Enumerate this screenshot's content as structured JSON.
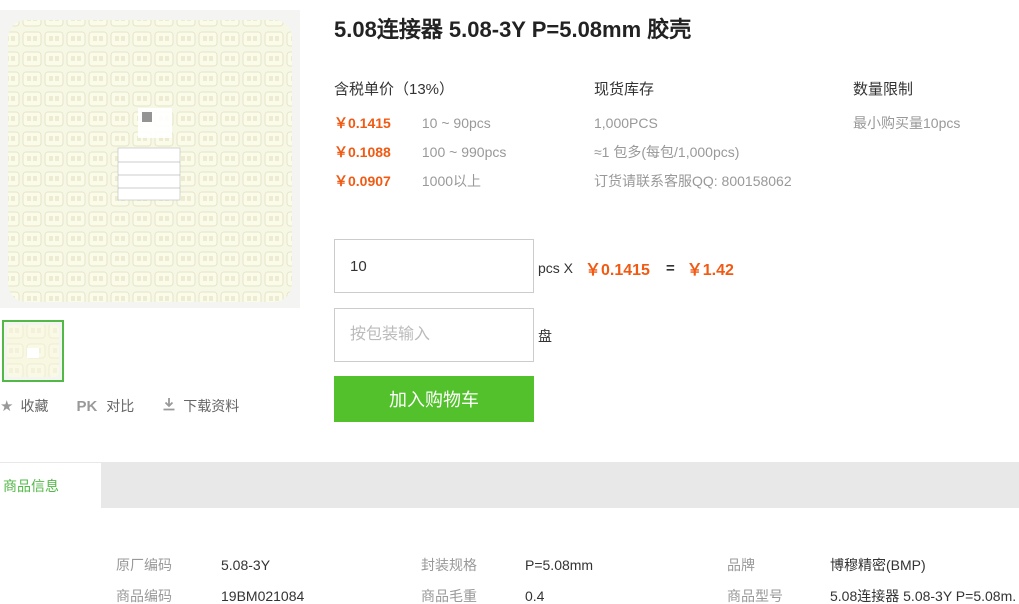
{
  "product": {
    "title": "5.08连接器 5.08-3Y P=5.08mm 胶壳"
  },
  "actions": {
    "favorite_label": "收藏",
    "compare_prefix": "PK",
    "compare_label": "对比",
    "download_label": "下载资料"
  },
  "pricing": {
    "header": "含税单价（13%）",
    "tiers": [
      {
        "price": "￥0.1415",
        "range": "10 ~ 90pcs"
      },
      {
        "price": "￥0.1088",
        "range": "100 ~ 990pcs"
      },
      {
        "price": "￥0.0907",
        "range": "1000以上"
      }
    ]
  },
  "stock": {
    "header": "现货库存",
    "lines": [
      "1,000PCS",
      "≈1 包多(每包/1,000pcs)",
      "订货请联系客服QQ: 800158062"
    ]
  },
  "limit": {
    "header": "数量限制",
    "text": "最小购买量10pcs"
  },
  "order": {
    "quantity_value": "10",
    "unit_label": "pcs X",
    "unit_price": "￥0.1415",
    "equals": "=",
    "total": "￥1.42",
    "package_placeholder": "按包装输入",
    "package_unit": "盘",
    "add_to_cart_label": "加入购物车"
  },
  "tabs": {
    "active_label": "商品信息"
  },
  "specs": {
    "left": [
      {
        "key": "原厂编码",
        "value": "5.08-3Y"
      },
      {
        "key": "商品编码",
        "value": "19BM021084"
      }
    ],
    "middle": [
      {
        "key": "封装规格",
        "value": "P=5.08mm"
      },
      {
        "key": "商品毛重",
        "value": "0.4"
      }
    ],
    "right": [
      {
        "key": "品牌",
        "value": "博穆精密(BMP)"
      },
      {
        "key": "商品型号",
        "value": "5.08连接器 5.08-3Y P=5.08m."
      }
    ]
  },
  "colors": {
    "accent_green": "#52c12b",
    "price_orange": "#f05a13"
  }
}
